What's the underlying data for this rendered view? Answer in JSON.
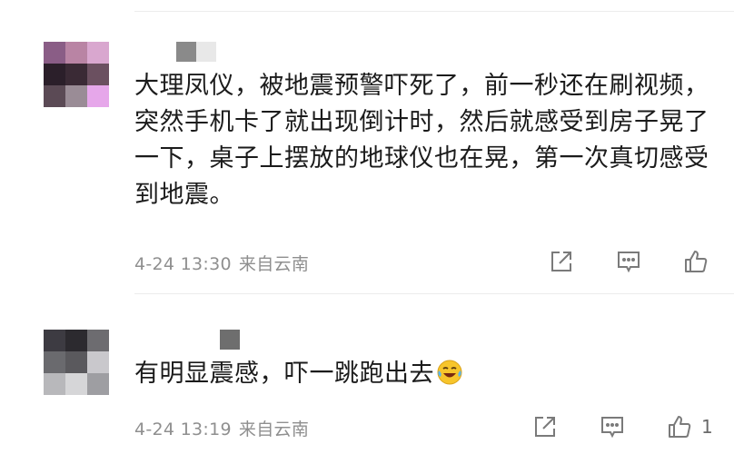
{
  "comments": [
    {
      "text": "大理凤仪，被地震预警吓死了，前一秒还在刷视频，突然手机卡了就出现倒计时，然后就感受到房子晃了一下，桌子上摆放的地球仪也在晃，第一次真切感受到地震。",
      "date": "4-24 13:30",
      "location": "来自云南",
      "like_count": "",
      "avatar_colors": [
        "#8a5d86",
        "#b984a4",
        "#d9a7cf",
        "#2b1f2a",
        "#3a2a35",
        "#6b5060",
        "#5b4a55",
        "#9a8c96",
        "#e6a7ea"
      ],
      "name_colors": [
        "#8a8a8a",
        "#e8e8e8"
      ]
    },
    {
      "text": "有明显震感，吓一跳跑出去",
      "date": "4-24 13:19",
      "location": "来自云南",
      "like_count": "1",
      "avatar_colors": [
        "#3d3b42",
        "#2c2a2f",
        "#6d6c70",
        "#6a6a6e",
        "#5a595d",
        "#c9c8cc",
        "#b8b8bb",
        "#d6d6d8",
        "#9e9ea2"
      ],
      "name_colors": [
        "#6e6e6e"
      ]
    }
  ],
  "icons": {
    "share": "share-icon",
    "reply": "reply-icon",
    "like": "thumbs-up-icon",
    "emoji": "laughing-tears-emoji"
  },
  "colors": {
    "text": "#1b1b1b",
    "meta": "#8f8f8f",
    "icon": "#7a7a7a",
    "divider": "#ececec",
    "emoji": "#f7c52b"
  }
}
